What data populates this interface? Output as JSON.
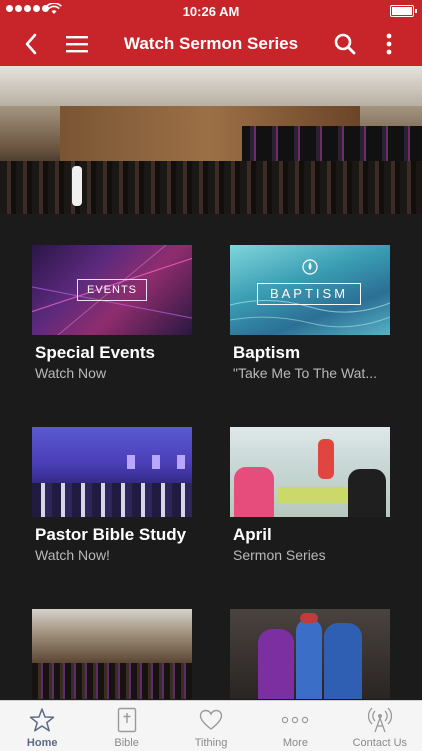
{
  "status_bar": {
    "time": "10:26 AM"
  },
  "nav": {
    "title": "Watch Sermon Series"
  },
  "cards": [
    {
      "title": "Special Events",
      "subtitle": "Watch Now",
      "thumb_text": "EVENTS"
    },
    {
      "title": "Baptism",
      "subtitle": "\"Take Me To The Wat...",
      "thumb_text": "BAPTISM"
    },
    {
      "title": "Pastor Bible Study",
      "subtitle": "Watch Now!"
    },
    {
      "title": "April",
      "subtitle": "Sermon Series"
    }
  ],
  "tabbar": {
    "items": [
      {
        "label": "Home",
        "icon": "star-icon",
        "active": true
      },
      {
        "label": "Bible",
        "icon": "bible-icon"
      },
      {
        "label": "Tithing",
        "icon": "heart-icon"
      },
      {
        "label": "More",
        "icon": "more-dots-icon"
      },
      {
        "label": "Contact Us",
        "icon": "antenna-icon"
      }
    ]
  },
  "colors": {
    "brand": "#c8252a",
    "tabbar_active": "#5b6b85"
  }
}
